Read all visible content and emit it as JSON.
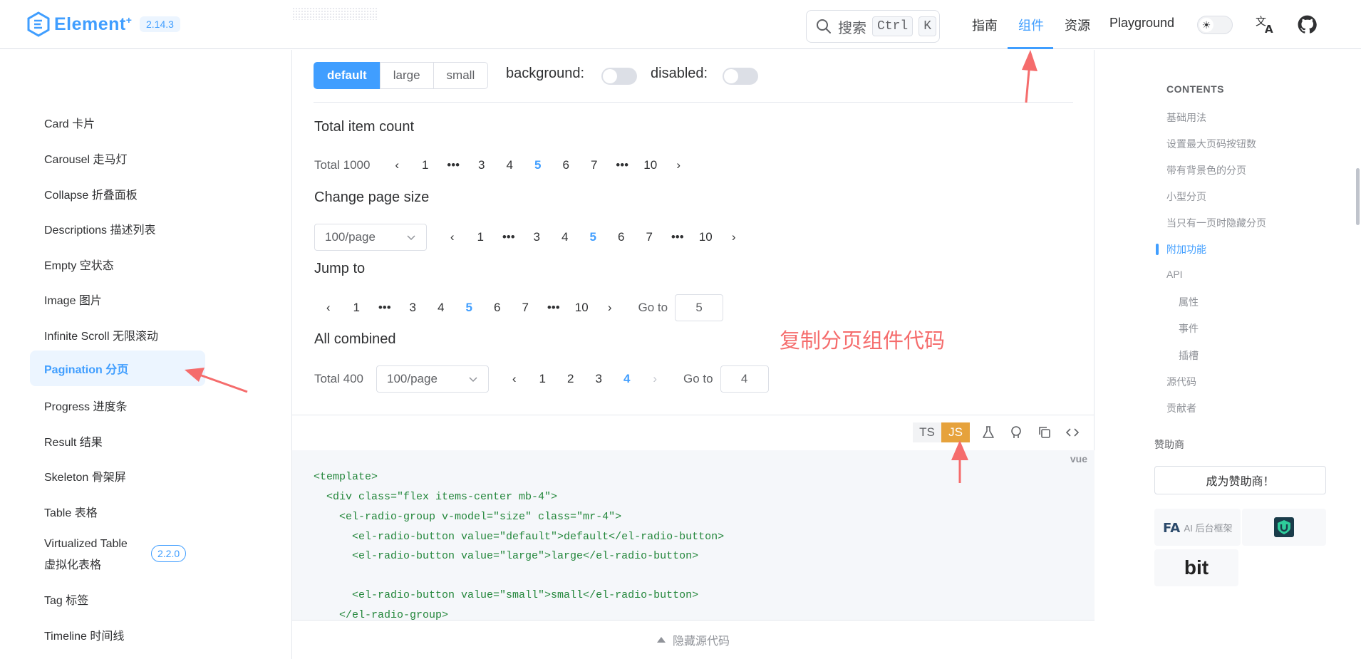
{
  "header": {
    "logo_text": "Element",
    "logo_sup": "+",
    "version": "2.14.3",
    "search_label": "搜索",
    "search_kbd1": "Ctrl",
    "search_kbd2": "K",
    "nav": [
      "指南",
      "组件",
      "资源",
      "Playground"
    ],
    "active_nav": "组件",
    "theme_icon": "sun-icon",
    "accent": "#409eff"
  },
  "sidebar": {
    "items": [
      "Card 卡片",
      "Carousel 走马灯",
      "Collapse 折叠面板",
      "Descriptions 描述列表",
      "Empty 空状态",
      "Image 图片",
      "Infinite Scroll 无限滚动",
      "Pagination 分页",
      "Progress 进度条",
      "Result 结果",
      "Skeleton 骨架屏",
      "Table 表格",
      "Virtualized Table",
      "虚拟化表格",
      "Tag 标签",
      "Timeline 时间线"
    ],
    "active_item": "Pagination 分页",
    "badge": "2.2.0"
  },
  "demo": {
    "radio": [
      "default",
      "large",
      "small"
    ],
    "radio_selected": "default",
    "background_label": "background:",
    "disabled_label": "disabled:",
    "sections": [
      "Total item count",
      "Change page size",
      "Jump to",
      "All combined"
    ],
    "total1": "Total 1000",
    "total2": "Total 400",
    "page_size": "100/page",
    "goto_label": "Go to",
    "goto1": "5",
    "goto2": "4",
    "pages_a": [
      "1",
      "•••",
      "3",
      "4",
      "5",
      "6",
      "7",
      "•••",
      "10"
    ],
    "pages_b": [
      "1",
      "2",
      "3",
      "4"
    ],
    "more": "•••",
    "annotation": "复制分页组件代码"
  },
  "code": {
    "ts": "TS",
    "js": "JS",
    "lang": "vue",
    "lines": [
      "<template>",
      "  <div class=\"flex items-center mb-4\">",
      "    <el-radio-group v-model=\"size\" class=\"mr-4\">",
      "      <el-radio-button value=\"default\">default</el-radio-button>",
      "      <el-radio-button value=\"large\">large</el-radio-button>",
      "",
      "      <el-radio-button value=\"small\">small</el-radio-button>",
      "    </el-radio-group>"
    ],
    "hide_label": "隐藏源代码"
  },
  "toc": {
    "title": "CONTENTS",
    "items": [
      "基础用法",
      "设置最大页码按钮数",
      "带有背景色的分页",
      "小型分页",
      "当只有一页时隐藏分页",
      "附加功能",
      "API",
      "属性",
      "事件",
      "插槽",
      "源代码",
      "贡献者"
    ],
    "active": "附加功能",
    "sponsor_title": "赞助商",
    "sponsor_btn": "成为赞助商！",
    "sponsor1": "AI 后台框架",
    "sponsor3": "bit"
  }
}
